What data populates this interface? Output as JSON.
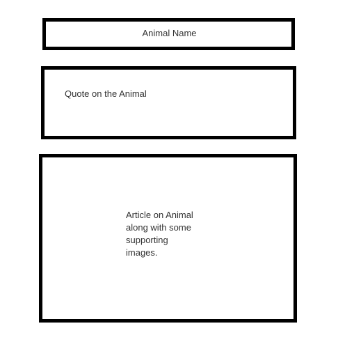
{
  "name_box": {
    "label": "Animal Name"
  },
  "quote_box": {
    "label": "Quote on the Animal"
  },
  "article_box": {
    "label": "Article on Animal\nalong with some\nsupporting\nimages."
  },
  "colors": {
    "border": "#000000",
    "background": "#ffffff",
    "text": "#333333"
  }
}
